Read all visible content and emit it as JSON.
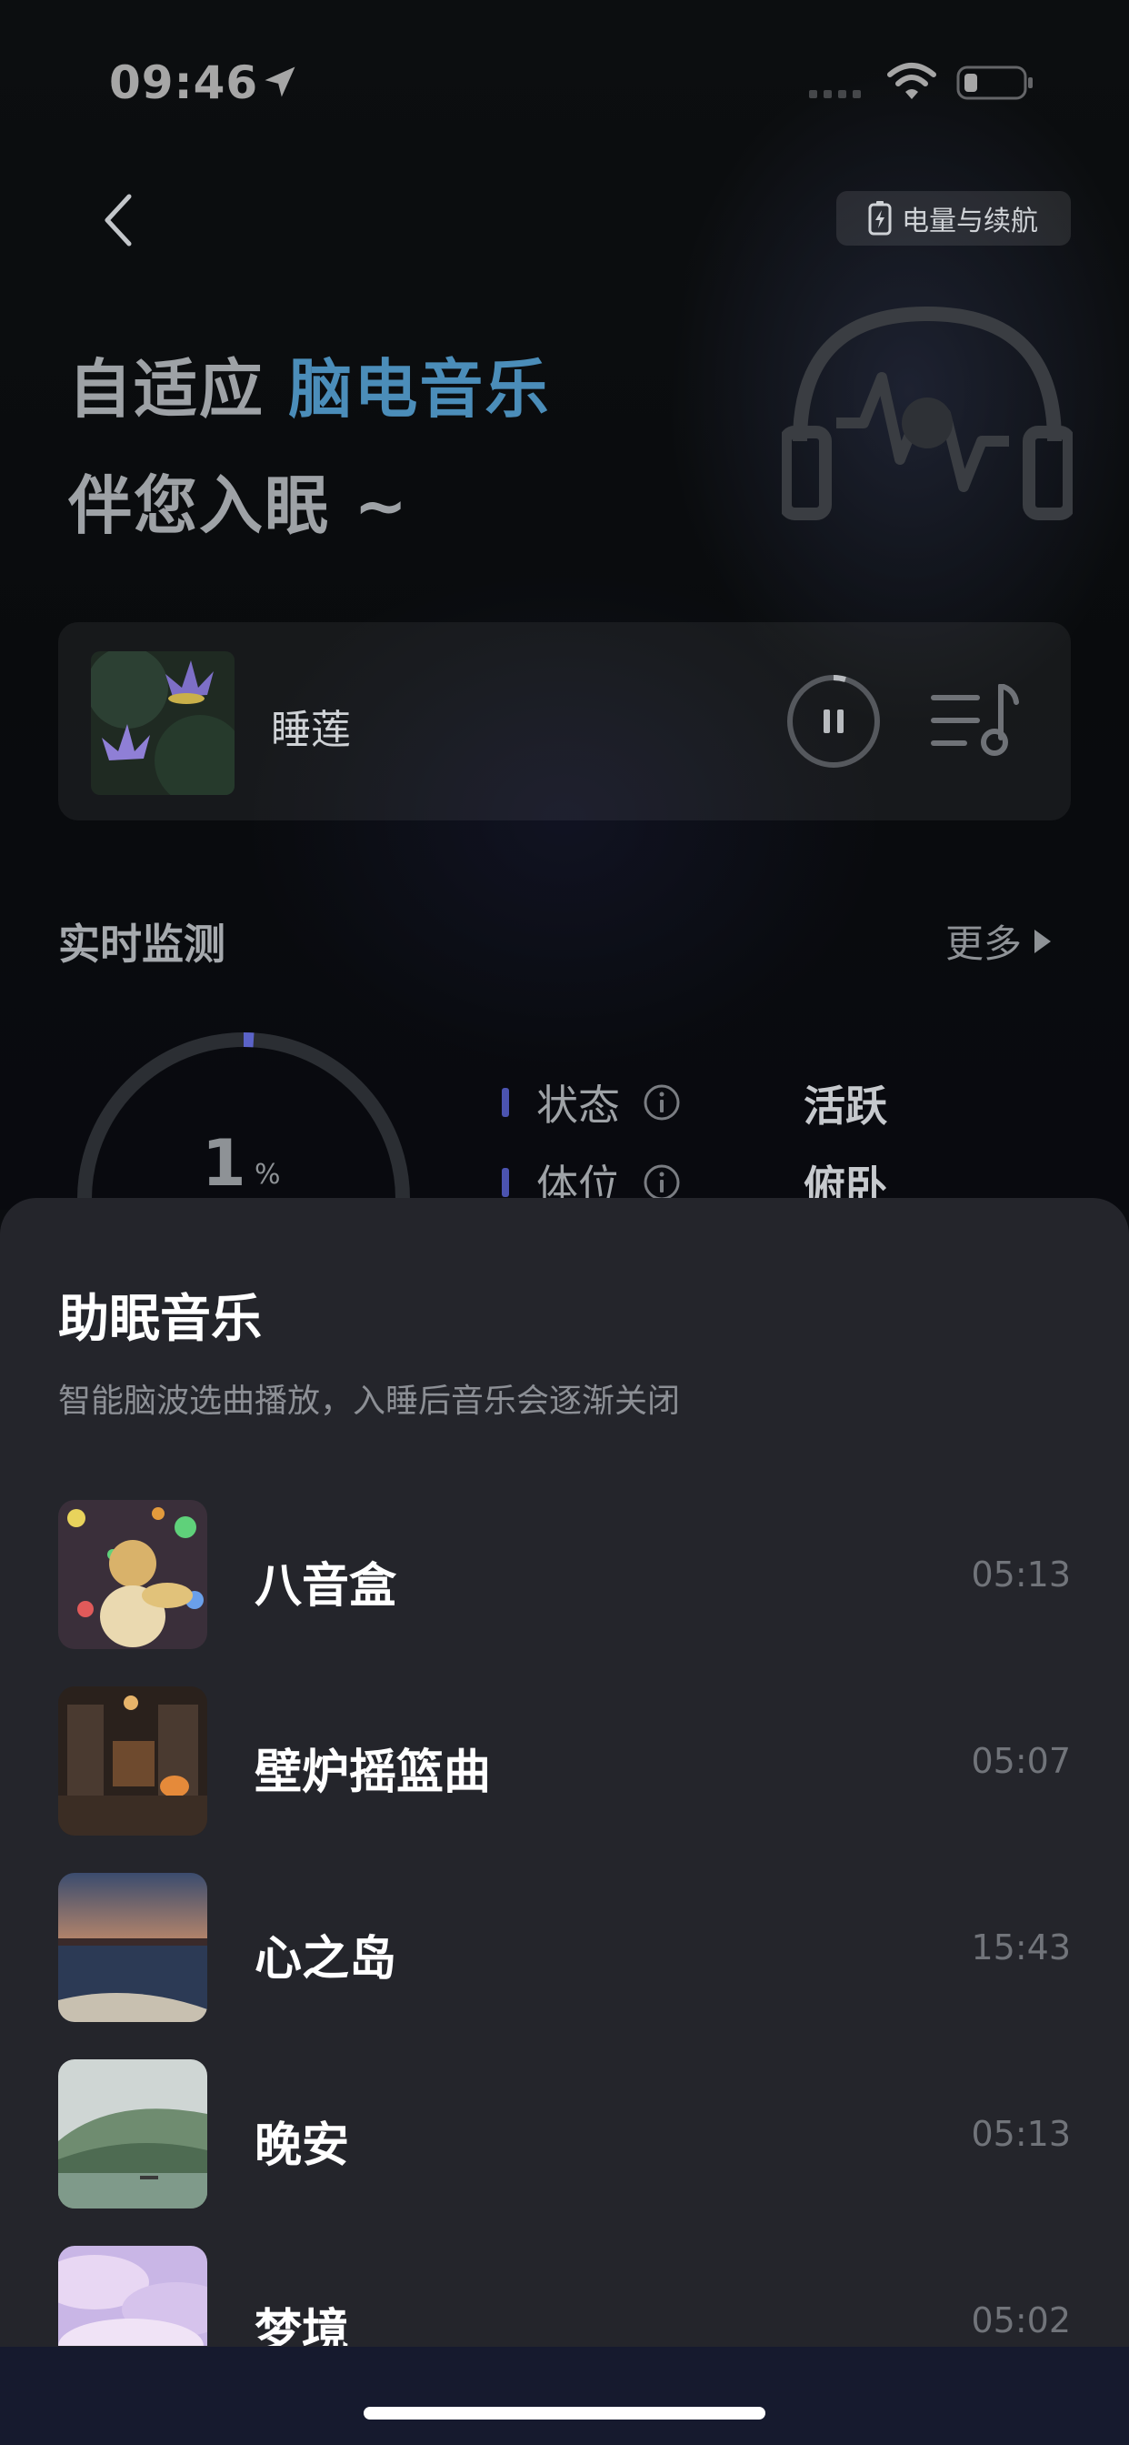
{
  "status_bar": {
    "time": "09:46"
  },
  "header": {
    "battery_chip_label": "电量与续航",
    "headline_part1": "自适应",
    "headline_accent": "脑电音乐",
    "headline_line2": "伴您入眠 ~"
  },
  "now_playing": {
    "title": "睡莲"
  },
  "monitoring": {
    "title": "实时监测",
    "more_label": "更多",
    "gauge_value": "1",
    "gauge_unit": "%",
    "gauge_fraction": 0.01,
    "stats": [
      {
        "label": "状态",
        "value": "活跃"
      },
      {
        "label": "体位",
        "value": "俯卧"
      }
    ]
  },
  "sheet": {
    "title": "助眠音乐",
    "subtitle": "智能脑波选曲播放，入睡后音乐会逐渐关闭",
    "tracks": [
      {
        "title": "八音盒",
        "duration": "05:13"
      },
      {
        "title": "壁炉摇篮曲",
        "duration": "05:07"
      },
      {
        "title": "心之岛",
        "duration": "15:43"
      },
      {
        "title": "晚安",
        "duration": "05:13"
      },
      {
        "title": "梦境",
        "duration": "05:02"
      }
    ]
  },
  "colors": {
    "accent": "#4b8db9",
    "sheet_bg": "#24252b",
    "stat_bar": "#4b53b0"
  }
}
